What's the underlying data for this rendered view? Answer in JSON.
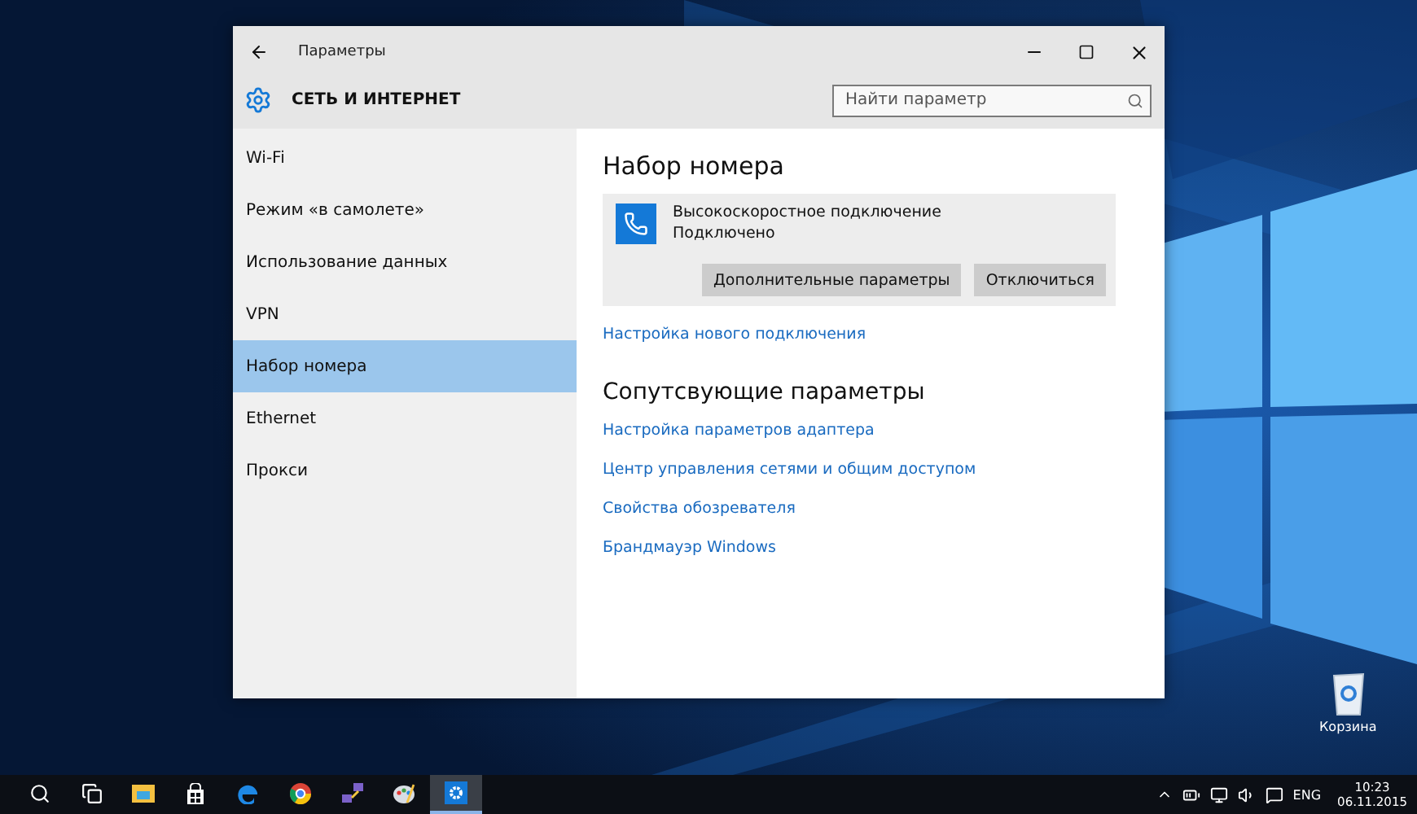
{
  "window": {
    "title": "Параметры",
    "section": "СЕТЬ И ИНТЕРНЕТ",
    "search": {
      "placeholder": "Найти параметр"
    }
  },
  "sidebar": {
    "items": [
      {
        "label": "Wi-Fi",
        "selected": false
      },
      {
        "label": "Режим «в самолете»",
        "selected": false
      },
      {
        "label": "Использование данных",
        "selected": false
      },
      {
        "label": "VPN",
        "selected": false
      },
      {
        "label": "Набор номера",
        "selected": true
      },
      {
        "label": "Ethernet",
        "selected": false
      },
      {
        "label": "Прокси",
        "selected": false
      }
    ]
  },
  "content": {
    "heading": "Набор номера",
    "connection": {
      "name": "Высокоскоростное подключение",
      "status": "Подключено",
      "buttons": [
        "Дополнительные параметры",
        "Отключиться"
      ]
    },
    "new_connection_link": "Настройка нового подключения",
    "related_heading": "Сопутсвующие параметры",
    "related_links": [
      "Настройка параметров адаптера",
      "Центр управления сетями и общим доступом",
      "Свойства обозревателя",
      "Брандмауэр Windows"
    ]
  },
  "desktop_icons": [
    {
      "label": "Корзина"
    }
  ],
  "taskbar": {
    "items": [
      {
        "kind": "search",
        "selected": false
      },
      {
        "kind": "taskview",
        "selected": false
      },
      {
        "kind": "explorer",
        "selected": false
      },
      {
        "kind": "store",
        "selected": false
      },
      {
        "kind": "edge",
        "selected": false
      },
      {
        "kind": "chrome",
        "selected": false
      },
      {
        "kind": "network",
        "selected": false
      },
      {
        "kind": "paint",
        "selected": false
      },
      {
        "kind": "settings",
        "selected": true
      }
    ],
    "tray": {
      "language": "ENG",
      "time": "10:23",
      "date": "06.11.2015"
    }
  }
}
